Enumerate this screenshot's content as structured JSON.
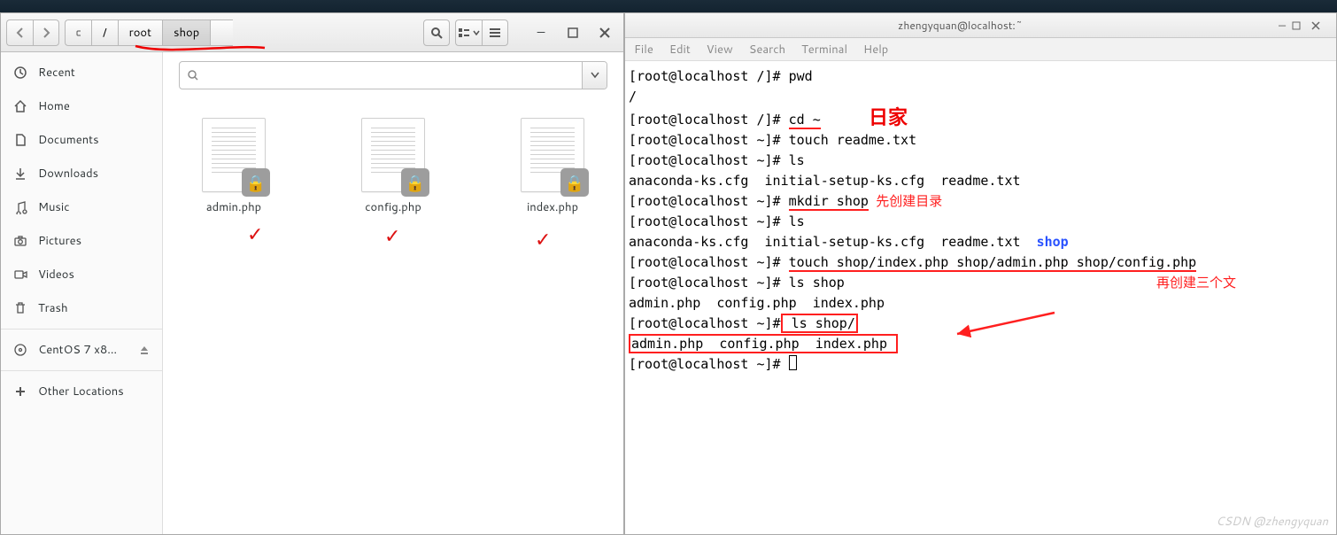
{
  "top_panel": {},
  "file_manager": {
    "nav": {
      "back_enabled": false,
      "forward_enabled": false
    },
    "path_picker_icon": "hdd-icon",
    "breadcrumbs": [
      "/",
      "root",
      "shop"
    ],
    "active_crumb": "shop",
    "window_controls": {
      "min": "–",
      "max": "❐",
      "close": "✕"
    },
    "sidebar": {
      "items": [
        {
          "icon": "clock-icon",
          "label": "Recent"
        },
        {
          "icon": "home-icon",
          "label": "Home"
        },
        {
          "icon": "doc-icon",
          "label": "Documents"
        },
        {
          "icon": "download-icon",
          "label": "Downloads"
        },
        {
          "icon": "music-icon",
          "label": "Music"
        },
        {
          "icon": "camera-icon",
          "label": "Pictures"
        },
        {
          "icon": "video-icon",
          "label": "Videos"
        },
        {
          "icon": "trash-icon",
          "label": "Trash"
        }
      ],
      "devices": [
        {
          "icon": "disc-icon",
          "label": "CentOS 7 x8…",
          "ejectable": true
        }
      ],
      "other": {
        "icon": "plus-icon",
        "label": "Other Locations"
      }
    },
    "search": {
      "placeholder": ""
    },
    "files": [
      {
        "name": "admin.php",
        "locked": true
      },
      {
        "name": "config.php",
        "locked": true
      },
      {
        "name": "index.php",
        "locked": true
      }
    ]
  },
  "terminal": {
    "title": "zhengyquan@localhost:~",
    "menus": [
      "File",
      "Edit",
      "View",
      "Search",
      "Terminal",
      "Help"
    ],
    "lines": [
      {
        "prompt": "[root@localhost /]# ",
        "cmd": "pwd"
      },
      {
        "text": "/"
      },
      {
        "prompt": "[root@localhost /]# ",
        "cmd_pre": "",
        "cmd_ul": "cd ~",
        "note_after": "   ",
        "hand": "日家"
      },
      {
        "prompt": "[root@localhost ~]# ",
        "cmd": "touch readme.txt"
      },
      {
        "prompt": "[root@localhost ~]# ",
        "cmd": "ls"
      },
      {
        "text": "anaconda-ks.cfg  initial-setup-ks.cfg  readme.txt"
      },
      {
        "prompt": "[root@localhost ~]# ",
        "cmd_ul": "mkdir shop",
        "note": "  先创建目录"
      },
      {
        "prompt": "[root@localhost ~]# ",
        "cmd": "ls"
      },
      {
        "text_pre": "anaconda-ks.cfg  initial-setup-ks.cfg  readme.txt  ",
        "blue": "shop"
      },
      {
        "prompt": "[root@localhost ~]# ",
        "cmd_ul": "touch shop/index.php shop/admin.php shop/config.php"
      },
      {
        "prompt": "[root@localhost ~]# ",
        "cmd": "ls shop",
        "note_far": "再创建三个文"
      },
      {
        "text": "admin.php  config.php  index.php"
      },
      {
        "prompt": "[root@localhost ~]#",
        "cmd_box": " ls shop/"
      },
      {
        "text_box": "admin.php  config.php  index.php "
      },
      {
        "prompt": "[root@localhost ~]# ",
        "cursor": true
      }
    ]
  },
  "watermark": "CSDN @zhengyquan",
  "annotations": {
    "path_underline": true,
    "file_checks": [
      "✓",
      "✓",
      "✓"
    ],
    "arrow_to_box": true
  }
}
